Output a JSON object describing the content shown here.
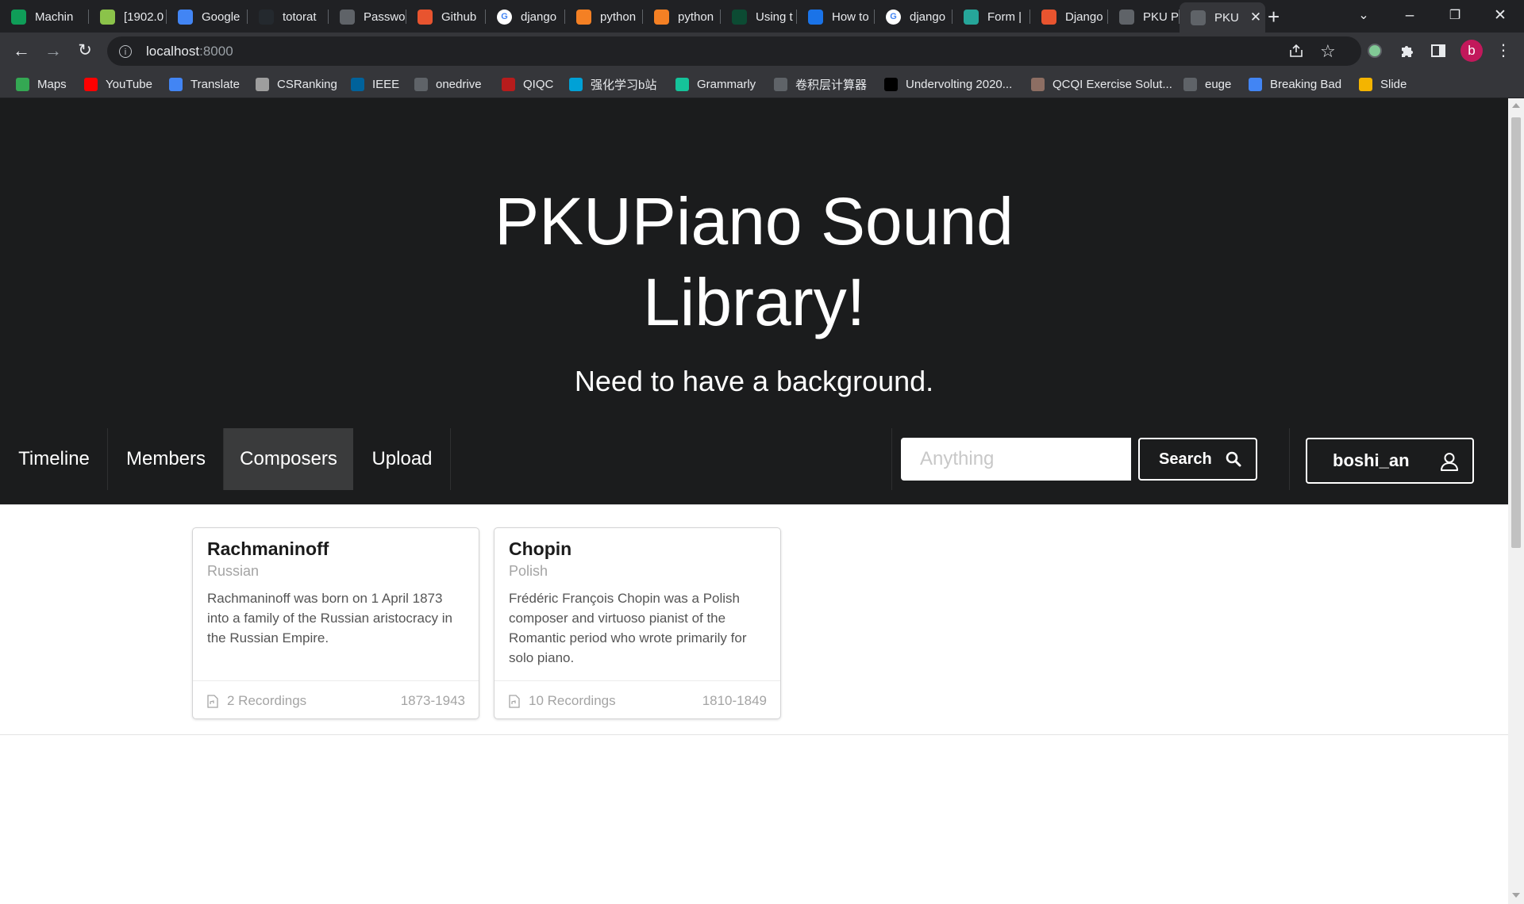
{
  "browser": {
    "tabs": [
      {
        "label": "Machin",
        "favicon": "leaf-icon",
        "color": "#0f9d58"
      },
      {
        "label": "[1902.0",
        "favicon": "smile-icon",
        "color": "#8bc34a"
      },
      {
        "label": "Google",
        "favicon": "translate-icon",
        "color": "#4285f4"
      },
      {
        "label": "totorat",
        "favicon": "github-icon",
        "color": "#24292e"
      },
      {
        "label": "Passwo",
        "favicon": "globe-icon",
        "color": "#5f6368"
      },
      {
        "label": "Github",
        "favicon": "c-icon",
        "color": "#e8542f"
      },
      {
        "label": "django",
        "favicon": "google-icon",
        "color": "#ffffff"
      },
      {
        "label": "python",
        "favicon": "stackoverflow-icon",
        "color": "#f48024"
      },
      {
        "label": "python",
        "favicon": "stackoverflow-icon",
        "color": "#f48024"
      },
      {
        "label": "Using t",
        "favicon": "django-icon",
        "color": "#0c4b33"
      },
      {
        "label": "How to",
        "favicon": "s-icon",
        "color": "#1a73e8"
      },
      {
        "label": "django",
        "favicon": "google-icon",
        "color": "#ffffff"
      },
      {
        "label": "Form |",
        "favicon": "s-icon",
        "color": "#26a69a"
      },
      {
        "label": "Django",
        "favicon": "c-icon",
        "color": "#e8542f"
      },
      {
        "label": "PKU Pi",
        "favicon": "globe-icon",
        "color": "#5f6368"
      },
      {
        "label": "PKU",
        "favicon": "globe-icon",
        "color": "#5f6368",
        "active": true
      }
    ],
    "address": {
      "host": "localhost",
      "port": ":8000"
    },
    "profile_initial": "b",
    "bookmarks": [
      {
        "label": "Maps",
        "icon": "maps-icon",
        "color": "#34a853"
      },
      {
        "label": "YouTube",
        "icon": "youtube-icon",
        "color": "#ff0000"
      },
      {
        "label": "Translate",
        "icon": "translate-icon",
        "color": "#4285f4"
      },
      {
        "label": "CSRanking",
        "icon": "magnifier-icon",
        "color": "#9e9e9e"
      },
      {
        "label": "IEEE",
        "icon": "ieee-icon",
        "color": "#00629b"
      },
      {
        "label": "onedrive",
        "icon": "onedrive-icon",
        "color": "#5f6368"
      },
      {
        "label": "QIQC",
        "icon": "qiqc-icon",
        "color": "#b71c1c"
      },
      {
        "label": "强化学习b站",
        "icon": "bilibili-icon",
        "color": "#00a1d6"
      },
      {
        "label": "Grammarly",
        "icon": "grammarly-icon",
        "color": "#15c39a"
      },
      {
        "label": "卷积层计算器",
        "icon": "globe-icon",
        "color": "#5f6368"
      },
      {
        "label": "Undervolting 2020...",
        "icon": "bg-icon",
        "color": "#000000"
      },
      {
        "label": "QCQI Exercise Solut...",
        "icon": "book-icon",
        "color": "#8d6e63"
      },
      {
        "label": "euge",
        "icon": "globe-icon",
        "color": "#5f6368"
      },
      {
        "label": "Breaking Bad",
        "icon": "mail-icon",
        "color": "#4285f4"
      },
      {
        "label": "Slide",
        "icon": "slides-icon",
        "color": "#f4b400"
      }
    ]
  },
  "site": {
    "title_line1": "PKUPiano Sound",
    "title_line2": "Library!",
    "subtitle": "Need to have a background.",
    "nav": {
      "timeline": "Timeline",
      "members": "Members",
      "composers": "Composers",
      "upload": "Upload"
    },
    "search": {
      "placeholder": "Anything",
      "button": "Search"
    },
    "user": {
      "name": "boshi_an"
    }
  },
  "composers": [
    {
      "name": "Rachmaninoff",
      "nationality": "Russian",
      "description": "Rachmaninoff was born on 1 April 1873 into a family of the Russian aristocracy in the Russian Empire.",
      "recordings": "2 Recordings",
      "years": "1873-1943"
    },
    {
      "name": "Chopin",
      "nationality": "Polish",
      "description": "Frédéric François Chopin was a Polish composer and virtuoso pianist of the Romantic period who wrote primarily for solo piano.",
      "recordings": "10 Recordings",
      "years": "1810-1849"
    }
  ]
}
